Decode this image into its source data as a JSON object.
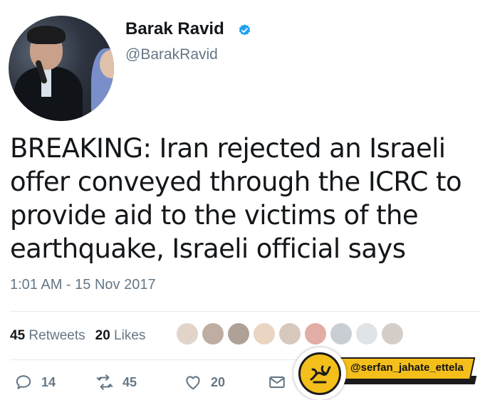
{
  "author": {
    "name": "Barak Ravid",
    "handle": "@BarakRavid",
    "verified": true,
    "verified_color": "#1da1f2"
  },
  "tweet": {
    "text": "BREAKING: Iran rejected an Israeli offer conveyed through the ICRC to provide aid to the victims of the earthquake, Israeli official says",
    "timestamp": "1:01 AM - 15 Nov 2017"
  },
  "stats": {
    "retweets_count": "45",
    "retweets_label": "Retweets",
    "likes_count": "20",
    "likes_label": "Likes"
  },
  "actions": {
    "reply_count": "14",
    "retweet_count": "45",
    "like_count": "20"
  },
  "watermark": {
    "text": "@serfan_jahate_ettela",
    "accent_color": "#f4bf1b"
  },
  "colors": {
    "text_primary": "#14171a",
    "text_secondary": "#657786",
    "divider": "#e6ecf0"
  }
}
